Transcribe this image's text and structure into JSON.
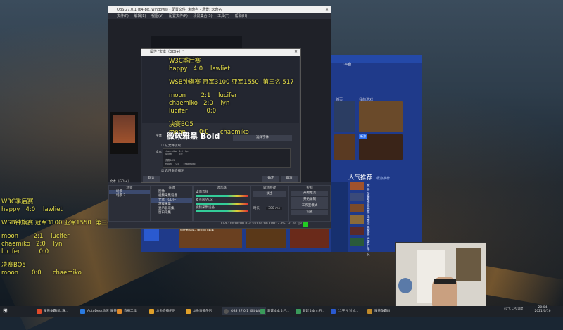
{
  "overlay": {
    "line1": "W3C季后赛",
    "line2": "happy   4:0    lawliet",
    "line3": "WSB钟旗赛 冠军3100 亚军1550  第三名 517",
    "line4": "moon        2:1    lucifer",
    "line5": "chaemiko   2:0    lyn",
    "line6": "lucifer          0:0",
    "line7": "决赛BO5",
    "line8": "moon       0:0      chaemiko"
  },
  "obs": {
    "title": "OBS 27.0.1 (64-bit, windows) - 配置文件: 未命名 - 场景: 未命名",
    "menu": [
      "文件(F)",
      "编辑(E)",
      "视图(V)",
      "配置文件(P)",
      "场景集合(S)",
      "工具(T)",
      "帮助(H)"
    ],
    "scene_label": "文本（GDI+）",
    "docks": {
      "scenes": "场景",
      "sources": "来源",
      "mixer": "混音器",
      "transitions": "转场特效",
      "controls": "控制"
    },
    "scenes": [
      "场景",
      "场景 2"
    ],
    "sources": [
      "图像",
      "视频采集设备",
      "文本（GDI+）",
      "游戏采集",
      "显示器采集",
      "窗口采集"
    ],
    "mixer_tracks": [
      "桌面音频",
      "麦克风/Aux",
      "视频采集设备"
    ],
    "transition": "淡出",
    "duration_label": "时长",
    "duration": "300 ms",
    "controls": [
      "开始推流",
      "开始录制",
      "工作室模式",
      "设置",
      "退出"
    ],
    "status": "LIVE: 00:00:00   REC: 00:00:00   CPU: 3.4%, 30.00 fps"
  },
  "dialog": {
    "title": "属性 '文本（GDI+）'",
    "font_label": "字体",
    "font_name": "微软雅黑 Bold",
    "select_font": "选择字体",
    "from_file": "从文件读取",
    "text_label": "文本",
    "text_content": "chaemiko   2:0   lyn\nlucifer        0:0\n\n决赛BO5\nmoon     0:0     chaemiko",
    "vertical": "启用垂直描述",
    "defaults": "默认",
    "ok": "确定",
    "cancel": "取消"
  },
  "platform": {
    "header": "11平台",
    "tabs": [
      "首页",
      "我的游戏"
    ],
    "popular": "人气推荐",
    "popular_sub": "畅游推荐",
    "new_badge": "新游",
    "games": [
      "魔兽争霸III",
      "英雄联盟",
      "风暴英雄",
      "守望先锋",
      "魔兽世界",
      "炉石传说",
      "暗黑破坏神III"
    ],
    "notice": "你还有游戏，请去大厅看看"
  },
  "taskbar": {
    "items": [
      "魔兽争霸III比赛...",
      "AutoDesk品牌_魔兽...",
      "直播工具",
      "斗鱼直播伴侣",
      "斗鱼直播伴侣",
      "OBS 27.0.1 (64-bit)",
      "新建文本文档...",
      "新建文本文档...",
      "11平台 对战...",
      "魔兽争霸III"
    ],
    "clock": "20:04",
    "date": "2021/6/16",
    "sys": "40°C CPU温度"
  },
  "colors": {
    "overlay_text": "#e8e14a",
    "platform_bg": "#1f3a8a",
    "obs_bg": "#2b2e38"
  }
}
